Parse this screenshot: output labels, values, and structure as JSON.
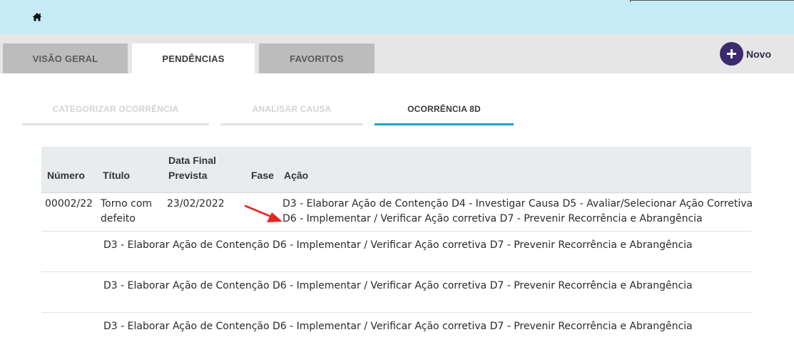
{
  "tabs": {
    "overview": "VISÃO GERAL",
    "pending": "PENDÊNCIAS",
    "favorites": "FAVORITOS"
  },
  "new_button": {
    "label": "Novo"
  },
  "subtabs": {
    "categorize": "CATEGORIZAR OCORRÊNCIA",
    "analyze": "ANALISAR CAUSA",
    "occurrence": "OCORRÊNCIA 8D"
  },
  "table": {
    "headers": {
      "number": "Número",
      "title": "Título",
      "date": "Data Final Prevista",
      "phase": "Fase",
      "action": "Ação"
    },
    "main_row": {
      "number": "00002/22",
      "title": "Torno com defeito",
      "date": "23/02/2022",
      "phase": "",
      "action_line1": "D3 - Elaborar Ação de Contenção D4 - Investigar Causa D5 - Avaliar/Selecionar Ação Corretiva",
      "action_line2": "D6 - Implementar / Verificar Ação corretiva D7 - Prevenir Recorrência e Abrangência"
    },
    "sub_rows": [
      "D3 - Elaborar Ação de Contenção D6 - Implementar / Verificar Ação corretiva D7 - Prevenir Recorrência e Abrangência",
      "D3 - Elaborar Ação de Contenção D6 - Implementar / Verificar Ação corretiva D7 - Prevenir Recorrência e Abrangência",
      "D3 - Elaborar Ação de Contenção D6 - Implementar / Verificar Ação corretiva D7 - Prevenir Recorrência e Abrangência"
    ]
  },
  "icons": {
    "home": "home-icon",
    "new": "plus-circle-icon",
    "annotation": "red-arrow-icon"
  },
  "colors": {
    "topbar": "#c5ecf4",
    "accent": "#1ea2c6",
    "new_button": "#3b2a6e",
    "arrow": "#e8231f"
  }
}
